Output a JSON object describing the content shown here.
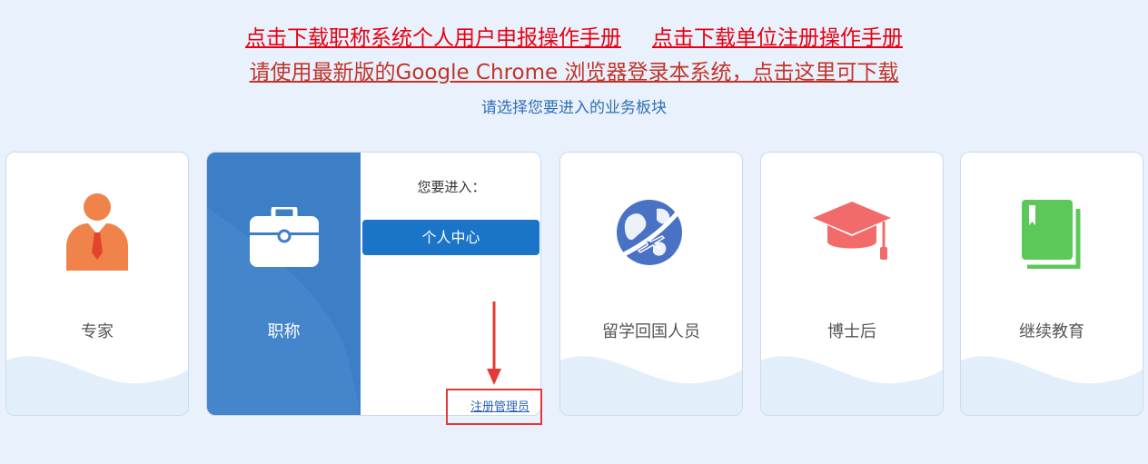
{
  "header": {
    "link_personal_manual": "点击下载职称系统个人用户申报操作手册",
    "link_unit_manual": "点击下载单位注册操作手册",
    "link_chrome": "请使用最新版的Google Chrome 浏览器登录本系统，点击这里可下载",
    "subtitle": "请选择您要进入的业务板块"
  },
  "cards": [
    {
      "label": "专家",
      "icon": "expert-person-icon"
    },
    {
      "label": "职称",
      "icon": "briefcase-icon"
    },
    {
      "label": "留学回国人员",
      "icon": "globe-airplane-icon"
    },
    {
      "label": "博士后",
      "icon": "graduation-cap-icon"
    },
    {
      "label": "继续教育",
      "icon": "book-icon"
    }
  ],
  "zhicheng_panel": {
    "enter_prompt": "您要进入：",
    "personal_center": "个人中心",
    "register_admin": "注册管理员"
  },
  "colors": {
    "link_red": "#e60012",
    "subtitle_blue": "#2f6fb5",
    "panel_blue": "#3d7fc6",
    "button_blue": "#1a74c8",
    "expert_orange": "#f0834a",
    "cap_red": "#f26b6b",
    "book_green": "#5cc85a",
    "globe_blue": "#4a72c4"
  }
}
